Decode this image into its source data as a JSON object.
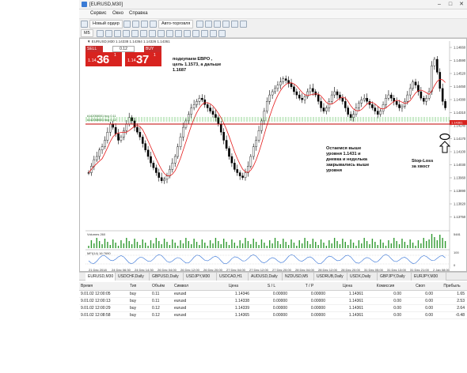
{
  "window": {
    "title": "[EURUSD,M30]"
  },
  "menu": [
    "Сервис",
    "Окно",
    "Справка"
  ],
  "toolbar": {
    "new_order_label": "Новый ордер",
    "autotrading_label": "Авто-торговля",
    "period_label": "M5"
  },
  "chart": {
    "caption": "▼ EURUSD,M30 1.14338 1.14364 1.14326 1.14361",
    "price_levels": [
      "1.14660",
      "1.14590",
      "1.14520",
      "1.14450",
      "1.14380",
      "1.14310",
      "1.14240",
      "1.14170",
      "1.14100",
      "1.14030",
      "1.13960",
      "1.13890",
      "1.13820",
      "1.13750"
    ],
    "dates": [
      "21 Dec 2018",
      "24 Dec 06:30",
      "24 Dec 14:30",
      "26 Dec 04:00",
      "26 Dec 12:00",
      "26 Dec 20:00",
      "27 Dec 04:00",
      "27 Dec 12:00",
      "27 Dec 20:00",
      "28 Dec 04:00",
      "28 Dec 12:00",
      "28 Dec 20:00",
      "31 Dec 05:00",
      "31 Dec 13:00",
      "31 Dec 21:00",
      "2 Jan 08:00"
    ],
    "hline_label": "#142058001 buy 0.11",
    "hline_label_2": "#142058001 buy 0.12",
    "marker_price": "1.14361",
    "volumes_label": "Volumes 260",
    "volumes_scale": "5481",
    "mfi_label": "MFI(14) 16.7690",
    "mfi_scale_top": "100",
    "mfi_scale_bottom": "0",
    "colors": {
      "bull_bear_candle": "#000000",
      "moving_average": "#e41b1b",
      "support_line": "#c00000",
      "order_lines": "#22aa22",
      "volume_bars": "#2f9a2f",
      "mfi_line": "#2f6fd6"
    }
  },
  "trade_panel": {
    "sell_label": "SELL",
    "buy_label": "BUY",
    "lot": "0.12",
    "sell_small": "1.14",
    "sell_big": "36",
    "sell_sup": "1",
    "buy_small": "1.14",
    "buy_big": "37",
    "buy_sup": "1"
  },
  "annotations": {
    "target": [
      "подкупаем ЕВРО ,",
      "цель 1.1573, а дальше",
      "1.1687"
    ],
    "support": [
      "Остаемся выше",
      "уровня 1.1431 и",
      "дневка и неделька",
      "закрывались выше",
      "уровня"
    ],
    "stop": [
      "Stop-Loss",
      "за хвост"
    ]
  },
  "tabs": [
    "EURUSD,M30",
    "USDCHF,Daily",
    "GBPUSD,Daily",
    "USDJPY,M30",
    "USDCAD,H1",
    "AUDUSD,Daily",
    "NZDUSD,M5",
    "USDRUB,Daily",
    "USDX,Daily",
    "GBPJPY,Daily",
    "EURJPY,M30"
  ],
  "table": {
    "headers": [
      "Время",
      "Тип",
      "Объём",
      "Символ",
      "Цена",
      "S / L",
      "T / P",
      "Цена",
      "Комиссия",
      "Своп",
      "Прибыль"
    ],
    "rows": [
      [
        "9.01.02 12:00:05",
        "buy",
        "0.11",
        "eurusd",
        "1.14346",
        "0.00000",
        "0.00000",
        "1.14361",
        "0.00",
        "0.00",
        "1.65"
      ],
      [
        "9.01.02 12:00:13",
        "buy",
        "0.11",
        "eurusd",
        "1.14338",
        "0.00000",
        "0.00000",
        "1.14361",
        "0.00",
        "0.00",
        "2.53"
      ],
      [
        "9.01.02 12:00:29",
        "buy",
        "0.12",
        "eurusd",
        "1.14339",
        "0.00000",
        "0.00000",
        "1.14361",
        "0.00",
        "0.00",
        "2.64"
      ],
      [
        "9.01.02 12:08:58",
        "buy",
        "0.12",
        "eurusd",
        "1.14365",
        "0.00000",
        "0.00000",
        "1.14361",
        "0.00",
        "0.00",
        "-0.48"
      ]
    ]
  }
}
